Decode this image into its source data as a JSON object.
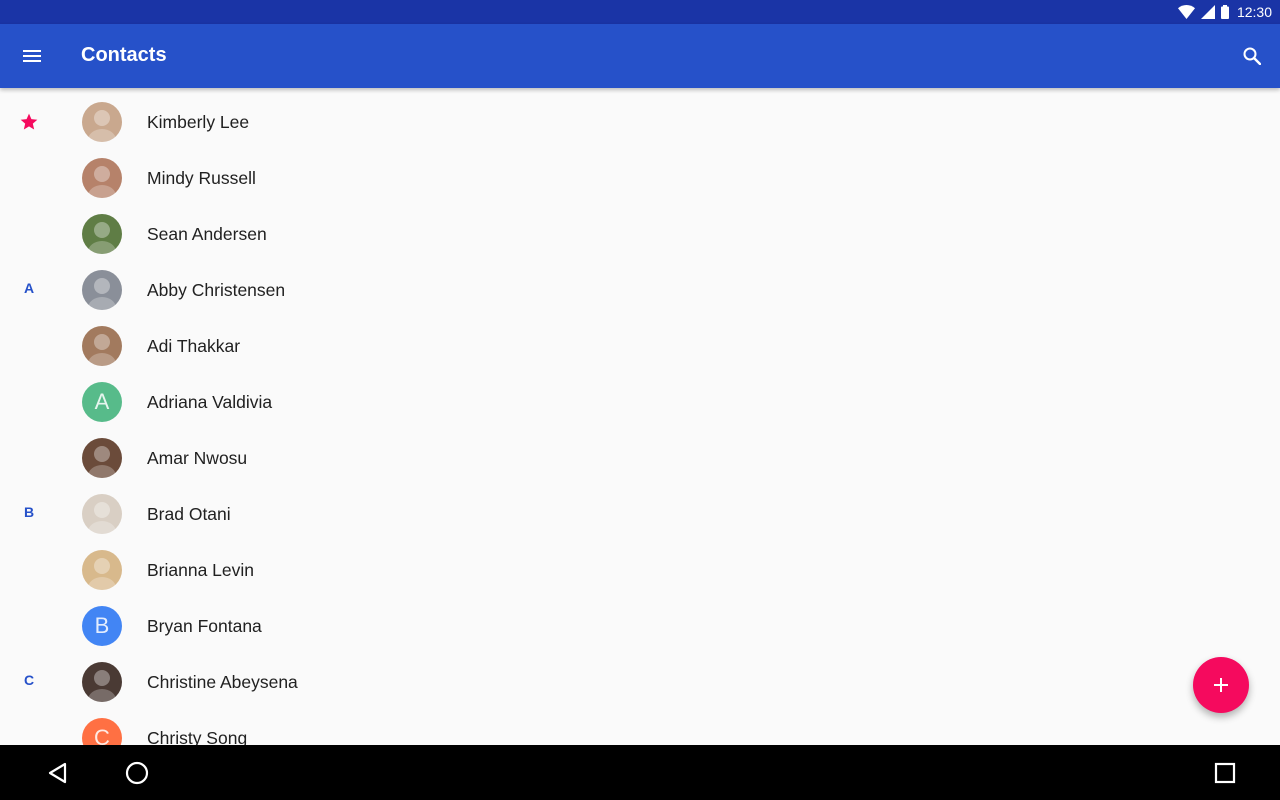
{
  "status_bar": {
    "time": "12:30",
    "icons": [
      "wifi-icon",
      "cell-signal-icon",
      "battery-icon"
    ]
  },
  "app_bar": {
    "title": "Contacts",
    "menu_icon": "menu-icon",
    "search_icon": "search-icon",
    "background": "#2651c9"
  },
  "contacts": [
    {
      "name": "Kimberly Lee",
      "section": "star",
      "avatar": "photo",
      "avatar_color": "#c9a88e"
    },
    {
      "name": "Mindy Russell",
      "section": "",
      "avatar": "photo",
      "avatar_color": "#b6826a"
    },
    {
      "name": "Sean Andersen",
      "section": "",
      "avatar": "photo",
      "avatar_color": "#5f7d45"
    },
    {
      "name": "Abby Christensen",
      "section": "A",
      "avatar": "photo",
      "avatar_color": "#8a8f99"
    },
    {
      "name": "Adi Thakkar",
      "section": "",
      "avatar": "photo",
      "avatar_color": "#a27a5e"
    },
    {
      "name": "Adriana Valdivia",
      "section": "",
      "avatar": "letter",
      "letter": "A",
      "avatar_color": "#57bb8a"
    },
    {
      "name": "Amar Nwosu",
      "section": "",
      "avatar": "photo",
      "avatar_color": "#6b4b3a"
    },
    {
      "name": "Brad Otani",
      "section": "B",
      "avatar": "photo",
      "avatar_color": "#d9cfc4"
    },
    {
      "name": "Brianna Levin",
      "section": "",
      "avatar": "photo",
      "avatar_color": "#d8b98c"
    },
    {
      "name": "Bryan Fontana",
      "section": "",
      "avatar": "letter",
      "letter": "B",
      "avatar_color": "#4285f4"
    },
    {
      "name": "Christine Abeysena",
      "section": "C",
      "avatar": "photo",
      "avatar_color": "#4a3a34"
    },
    {
      "name": "Christy Song",
      "section": "",
      "avatar": "letter",
      "letter": "C",
      "avatar_color": "#ff7043"
    }
  ],
  "fab": {
    "icon": "add-icon",
    "color": "#f50a5e"
  },
  "nav_bar": {
    "buttons": [
      "back-icon",
      "home-icon",
      "recents-icon"
    ]
  },
  "colors": {
    "accent": "#f50a5e",
    "section_letter": "#2651c9",
    "status_bar": "#1a34a6"
  }
}
